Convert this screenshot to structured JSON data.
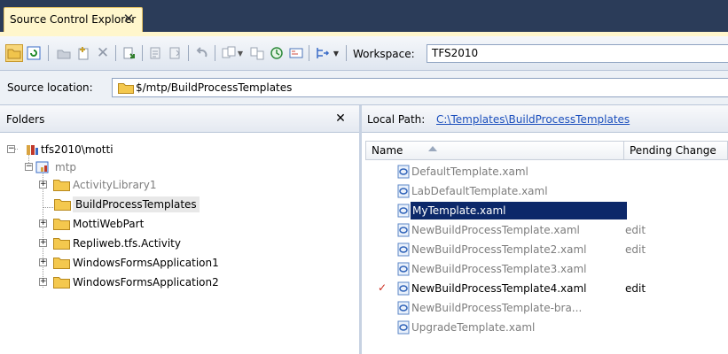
{
  "tab": {
    "title": "Source Control Explorer",
    "close_glyph": "✕"
  },
  "toolbar": {
    "workspace_label": "Workspace:",
    "workspace_value": "TFS2010"
  },
  "source": {
    "label": "Source location:",
    "path": "$/mtp/BuildProcessTemplates"
  },
  "folders_panel": {
    "title": "Folders",
    "close_glyph": "✕",
    "nodes": [
      {
        "label": "tfs2010\\motti"
      },
      {
        "label": "mtp"
      },
      {
        "label": "ActivityLibrary1"
      },
      {
        "label": "BuildProcessTemplates"
      },
      {
        "label": "MottiWebPart"
      },
      {
        "label": "Repliweb.tfs.Activity"
      },
      {
        "label": "WindowsFormsApplication1"
      },
      {
        "label": "WindowsFormsApplication2"
      }
    ]
  },
  "files_panel": {
    "local_path_label": "Local Path:",
    "local_path": "C:\\Templates\\BuildProcessTemplates",
    "columns": {
      "name": "Name",
      "pending": "Pending Change"
    },
    "files": [
      {
        "name": "DefaultTemplate.xaml",
        "pending": ""
      },
      {
        "name": "LabDefaultTemplate.xaml",
        "pending": ""
      },
      {
        "name": "MyTemplate.xaml",
        "pending": ""
      },
      {
        "name": "NewBuildProcessTemplate.xaml",
        "pending": "edit"
      },
      {
        "name": "NewBuildProcessTemplate2.xaml",
        "pending": "edit"
      },
      {
        "name": "NewBuildProcessTemplate3.xaml",
        "pending": ""
      },
      {
        "name": "NewBuildProcessTemplate4.xaml",
        "pending": "edit"
      },
      {
        "name": "NewBuildProcessTemplate-bra...",
        "pending": ""
      },
      {
        "name": "UpgradeTemplate.xaml",
        "pending": ""
      }
    ],
    "checkmark": "✓"
  },
  "colors": {
    "selection": "#0c2869",
    "accent": "#2b3c59",
    "tab_bg": "#fff6cc"
  }
}
